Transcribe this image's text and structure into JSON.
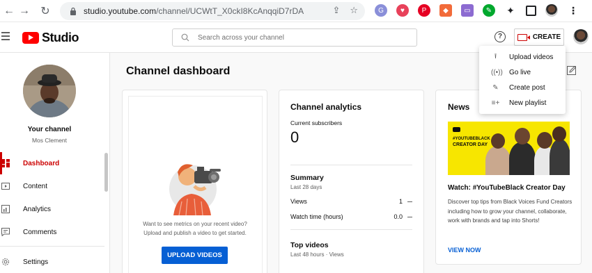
{
  "browser": {
    "url_host": "studio.youtube.com",
    "url_path": "/channel/UCWtT_X0ckI8KcAnqqiD7rDA"
  },
  "header": {
    "logo_text": "Studio",
    "search_placeholder": "Search across your channel",
    "help_glyph": "?",
    "create_label": "CREATE"
  },
  "create_menu": {
    "items": [
      {
        "label": "Upload videos",
        "icon": "upload-icon"
      },
      {
        "label": "Go live",
        "icon": "live-icon"
      },
      {
        "label": "Create post",
        "icon": "post-icon"
      },
      {
        "label": "New playlist",
        "icon": "playlist-icon"
      }
    ]
  },
  "sidebar": {
    "channel_label": "Your channel",
    "channel_name": "Mos Clement",
    "items": [
      {
        "label": "Dashboard",
        "icon": "dashboard-icon",
        "active": true
      },
      {
        "label": "Content",
        "icon": "content-icon"
      },
      {
        "label": "Analytics",
        "icon": "analytics-icon"
      },
      {
        "label": "Comments",
        "icon": "comments-icon"
      },
      {
        "label": "Settings",
        "icon": "settings-icon"
      }
    ]
  },
  "main": {
    "title": "Channel dashboard",
    "upload_card": {
      "prompt": "Want to see metrics on your recent video? Upload and publish a video to get started.",
      "button_label": "UPLOAD VIDEOS"
    },
    "analytics": {
      "title": "Channel analytics",
      "subscribers_label": "Current subscribers",
      "subscribers_value": "0",
      "summary_title": "Summary",
      "summary_period": "Last 28 days",
      "rows": [
        {
          "label": "Views",
          "value": "1"
        },
        {
          "label": "Watch time (hours)",
          "value": "0.0"
        }
      ],
      "top_videos_title": "Top videos",
      "top_videos_period": "Last 48 hours · Views"
    },
    "news": {
      "title": "News",
      "image_tag1": "#YOUTUBEBLACK",
      "image_tag2": "CREATOR DAY",
      "headline": "Watch: #YouTubeBlack Creator Day",
      "body": "Discover top tips from Black Voices Fund Creators including how to grow your channel, collaborate, work with brands and tap into Shorts!",
      "link_label": "VIEW NOW"
    }
  },
  "colors": {
    "accent_red": "#cc0000",
    "link_blue": "#065fd4",
    "news_yellow": "#f7e600"
  }
}
